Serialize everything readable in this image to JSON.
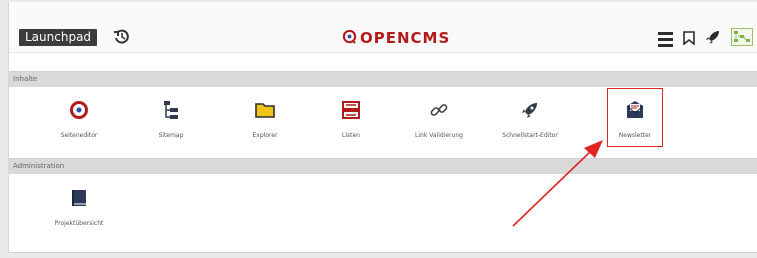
{
  "topbar": {
    "launchpad_label": "Launchpad",
    "logo_text": "OPENCMS",
    "icons": [
      "history-icon",
      "opencms-logo-icon",
      "menu-icon",
      "bookmark-icon",
      "rocket-icon",
      "sitemap-preview-icon"
    ]
  },
  "sections": [
    {
      "title": "Inhalte",
      "apps": [
        {
          "label": "Seiteneditor",
          "icon": "target-icon"
        },
        {
          "label": "Sitemap",
          "icon": "sitemap-icon"
        },
        {
          "label": "Explorer",
          "icon": "folder-icon"
        },
        {
          "label": "Listen",
          "icon": "list-icon"
        },
        {
          "label": "Link Validierung",
          "icon": "link-icon"
        },
        {
          "label": "Schnellstart-Editor",
          "icon": "rocket-icon"
        },
        {
          "label": "Newsletter",
          "icon": "newsletter-icon"
        }
      ]
    },
    {
      "title": "Administration",
      "apps": [
        {
          "label": "Projektübersicht",
          "icon": "book-icon"
        }
      ]
    }
  ],
  "colors": {
    "accent": "#b31b1b",
    "highlight": "#e02424",
    "folder": "#f0c419",
    "section_bg": "#d9d9d9"
  }
}
